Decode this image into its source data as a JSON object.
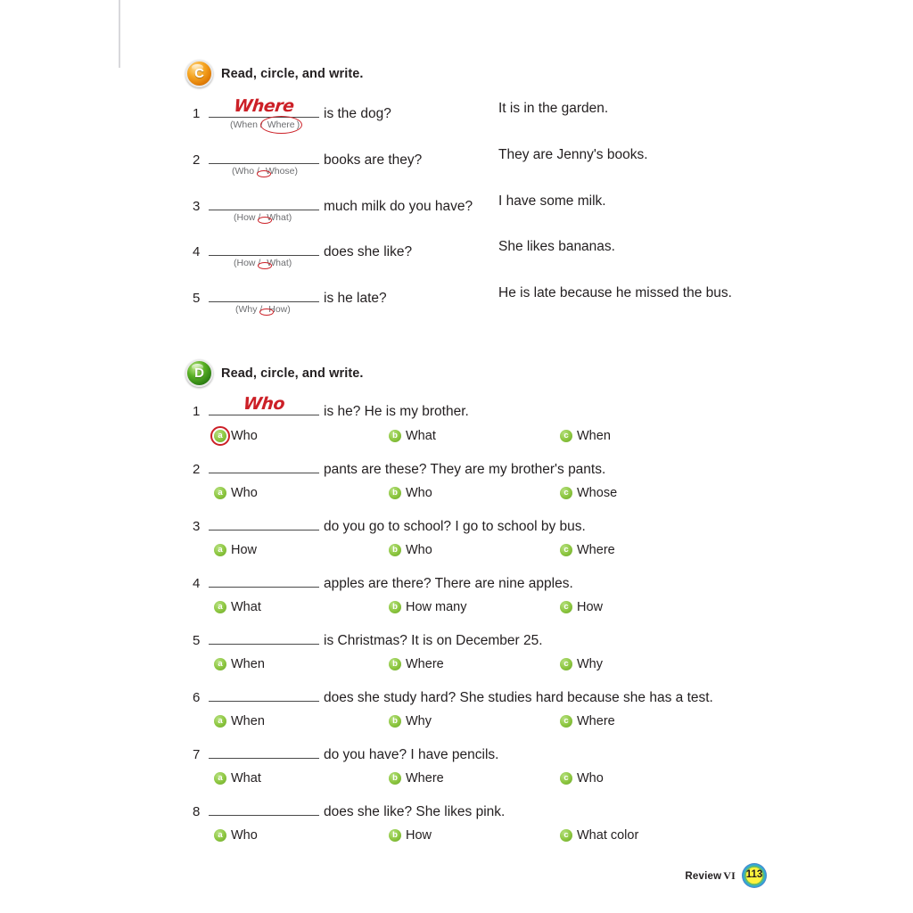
{
  "page": {
    "footer_label": "Review",
    "footer_roman": "VI",
    "page_number": "113"
  },
  "section_c": {
    "badge_letter": "C",
    "title": "Read, circle, and write.",
    "items": [
      {
        "number": "1",
        "answer": "Where",
        "question": "is the dog?",
        "response": "It is in the garden.",
        "hint_open": "(When / ",
        "hint_circled": "Where",
        "hint_close": ")"
      },
      {
        "number": "2",
        "answer": "",
        "question": "books are they?",
        "response": "They are Jenny's books.",
        "hint_open": "(Who / ",
        "hint_circled": "",
        "hint_close": "Whose)"
      },
      {
        "number": "3",
        "answer": "",
        "question": "much milk do you have?",
        "response": "I have some milk.",
        "hint_open": "(How / ",
        "hint_circled": "",
        "hint_close": "What)"
      },
      {
        "number": "4",
        "answer": "",
        "question": "does she like?",
        "response": "She likes bananas.",
        "hint_open": "(How / ",
        "hint_circled": "",
        "hint_close": "What)"
      },
      {
        "number": "5",
        "answer": "",
        "question": "is he late?",
        "response": "He is late because he missed the bus.",
        "hint_open": "(Why / ",
        "hint_circled": "",
        "hint_close": "How)"
      }
    ]
  },
  "section_d": {
    "badge_letter": "D",
    "title": "Read, circle, and write.",
    "items": [
      {
        "number": "1",
        "answer": "Who",
        "question": "is he?  He is my brother.",
        "options": [
          {
            "key": "a",
            "label": "Who",
            "marked": true
          },
          {
            "key": "b",
            "label": "What",
            "marked": false
          },
          {
            "key": "c",
            "label": "When",
            "marked": false
          }
        ]
      },
      {
        "number": "2",
        "answer": "",
        "question": "pants are these?  They are my brother's pants.",
        "options": [
          {
            "key": "a",
            "label": "Who",
            "marked": false
          },
          {
            "key": "b",
            "label": "Who",
            "marked": false
          },
          {
            "key": "c",
            "label": "Whose",
            "marked": false
          }
        ]
      },
      {
        "number": "3",
        "answer": "",
        "question": "do you go to school?  I go to school by bus.",
        "options": [
          {
            "key": "a",
            "label": "How",
            "marked": false
          },
          {
            "key": "b",
            "label": "Who",
            "marked": false
          },
          {
            "key": "c",
            "label": "Where",
            "marked": false
          }
        ]
      },
      {
        "number": "4",
        "answer": "",
        "question": "apples are there?  There are nine apples.",
        "options": [
          {
            "key": "a",
            "label": "What",
            "marked": false
          },
          {
            "key": "b",
            "label": "How many",
            "marked": false
          },
          {
            "key": "c",
            "label": "How",
            "marked": false
          }
        ]
      },
      {
        "number": "5",
        "answer": "",
        "question": "is Christmas?   It is on December 25.",
        "options": [
          {
            "key": "a",
            "label": "When",
            "marked": false
          },
          {
            "key": "b",
            "label": "Where",
            "marked": false
          },
          {
            "key": "c",
            "label": "Why",
            "marked": false
          }
        ]
      },
      {
        "number": "6",
        "answer": "",
        "question": "does she study hard?  She studies hard because she has a test.",
        "options": [
          {
            "key": "a",
            "label": "When",
            "marked": false
          },
          {
            "key": "b",
            "label": "Why",
            "marked": false
          },
          {
            "key": "c",
            "label": "Where",
            "marked": false
          }
        ]
      },
      {
        "number": "7",
        "answer": "",
        "question": "do you have?  I have pencils.",
        "options": [
          {
            "key": "a",
            "label": "What",
            "marked": false
          },
          {
            "key": "b",
            "label": "Where",
            "marked": false
          },
          {
            "key": "c",
            "label": "Who",
            "marked": false
          }
        ]
      },
      {
        "number": "8",
        "answer": "",
        "question": "does she like?  She likes pink.",
        "options": [
          {
            "key": "a",
            "label": "Who",
            "marked": false
          },
          {
            "key": "b",
            "label": "How",
            "marked": false
          },
          {
            "key": "c",
            "label": "What color",
            "marked": false
          }
        ]
      }
    ]
  },
  "colors": {
    "handwriting_red": "#cc2027",
    "bullet_green": "#8cc63f",
    "badge_orange": "#f6a623",
    "badge_green": "#59b024"
  }
}
